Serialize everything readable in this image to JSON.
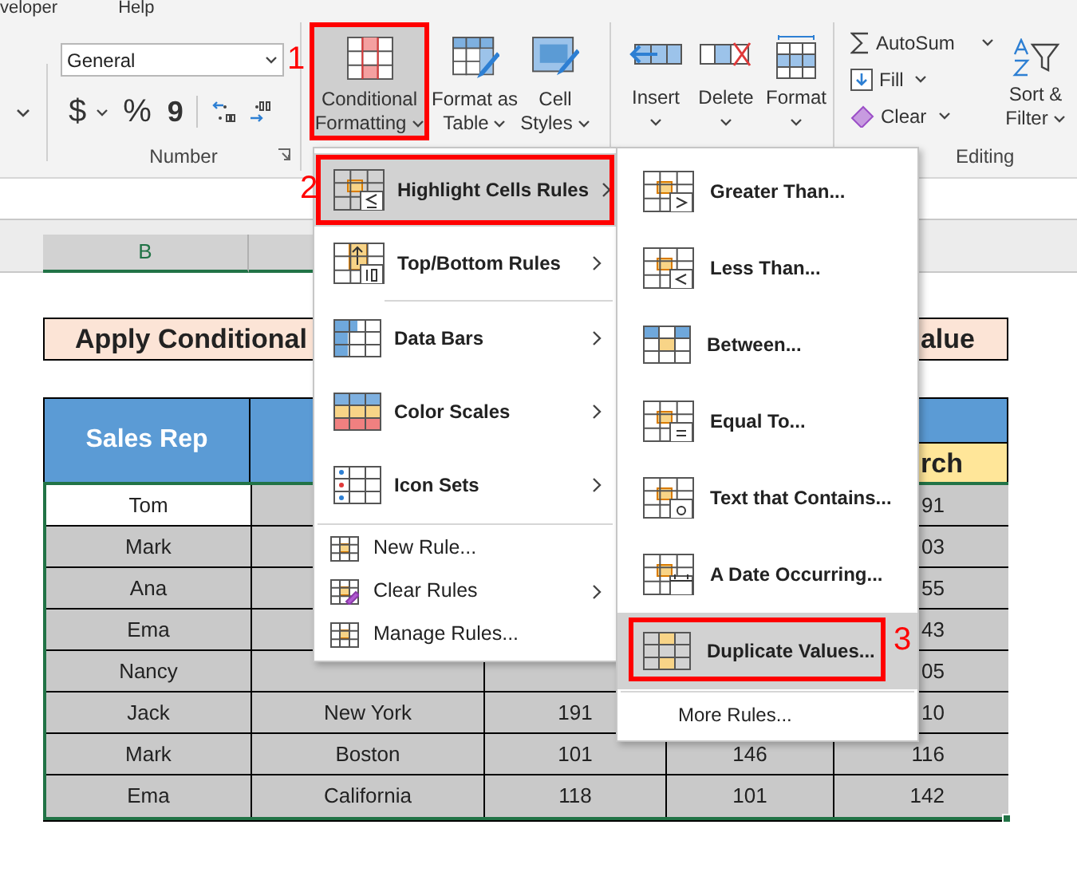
{
  "ribbon_tabs": [
    {
      "label": "veloper"
    },
    {
      "label": "Help"
    }
  ],
  "number_group": {
    "format": {
      "value": "General"
    },
    "buttons": [
      "$",
      "%",
      "9"
    ],
    "label": "Number"
  },
  "styles_group": {
    "buttons": [
      {
        "lines": [
          "Conditional",
          "Formatting"
        ],
        "selected": true,
        "callout": "1"
      },
      {
        "lines": [
          "Format as",
          "Table"
        ],
        "selected": false
      },
      {
        "lines": [
          "Cell",
          "Styles"
        ],
        "selected": false
      }
    ]
  },
  "cells_group": {
    "buttons": [
      {
        "label": "Insert"
      },
      {
        "label": "Delete"
      },
      {
        "label": "Format"
      }
    ]
  },
  "editing_group": {
    "items": [
      {
        "label": "AutoSum"
      },
      {
        "label": "Fill"
      },
      {
        "label": "Clear"
      }
    ],
    "sort": {
      "lines": [
        "Sort &",
        "Filter"
      ]
    },
    "label": "Editing"
  },
  "sheet": {
    "column_header": "B",
    "title_left": "Apply Conditional",
    "title_right": "alue",
    "headers": {
      "sales_rep": "Sales Rep",
      "column_f": "rch"
    },
    "rows": [
      {
        "sales_rep": "Tom",
        "column_f": "91",
        "active": true
      },
      {
        "sales_rep": "Mark",
        "column_f": "03",
        "active": false
      },
      {
        "sales_rep": "Ana",
        "column_f": "55",
        "active": false
      },
      {
        "sales_rep": "Ema",
        "column_f": "43",
        "active": false
      },
      {
        "sales_rep": "Nancy",
        "column_f": "05",
        "active": false
      },
      {
        "sales_rep": "Jack",
        "column_c": "New York",
        "column_d": "191",
        "column_f": "10",
        "active": false
      },
      {
        "sales_rep": "Mark",
        "column_c": "Boston",
        "column_d": "101",
        "column_e": "146",
        "column_f": "116",
        "active": false
      },
      {
        "sales_rep": "Ema",
        "column_c": "California",
        "column_d": "118",
        "column_e": "101",
        "column_f": "142",
        "active": false
      }
    ]
  },
  "menu": {
    "items": [
      {
        "kind": "large",
        "label": "Highlight Cells Rules",
        "submenu": true,
        "selected": true,
        "callout": "2"
      },
      {
        "kind": "large",
        "label": "Top/Bottom Rules",
        "submenu": true,
        "selected": false
      },
      {
        "kind": "large",
        "label": "Data Bars",
        "submenu": true,
        "selected": false
      },
      {
        "kind": "large",
        "label": "Color Scales",
        "submenu": true,
        "selected": false
      },
      {
        "kind": "large",
        "label": "Icon Sets",
        "submenu": true,
        "selected": false
      },
      {
        "kind": "small",
        "label": "New Rule...",
        "submenu": false,
        "selected": false
      },
      {
        "kind": "small",
        "label": "Clear Rules",
        "submenu": true,
        "selected": false
      },
      {
        "kind": "small",
        "label": "Manage Rules...",
        "submenu": false,
        "selected": false
      }
    ]
  },
  "submenu": {
    "items": [
      {
        "kind": "large",
        "label": "Greater Than...",
        "selected": false
      },
      {
        "kind": "large",
        "label": "Less Than...",
        "selected": false
      },
      {
        "kind": "large",
        "label": "Between...",
        "selected": false
      },
      {
        "kind": "large",
        "label": "Equal To...",
        "selected": false
      },
      {
        "kind": "large",
        "label": "Text that Contains...",
        "selected": false
      },
      {
        "kind": "large",
        "label": "A Date Occurring...",
        "selected": false
      },
      {
        "kind": "large",
        "label": "Duplicate Values...",
        "selected": true,
        "callout": "3"
      },
      {
        "kind": "small",
        "label": "More Rules...",
        "selected": false
      }
    ]
  }
}
